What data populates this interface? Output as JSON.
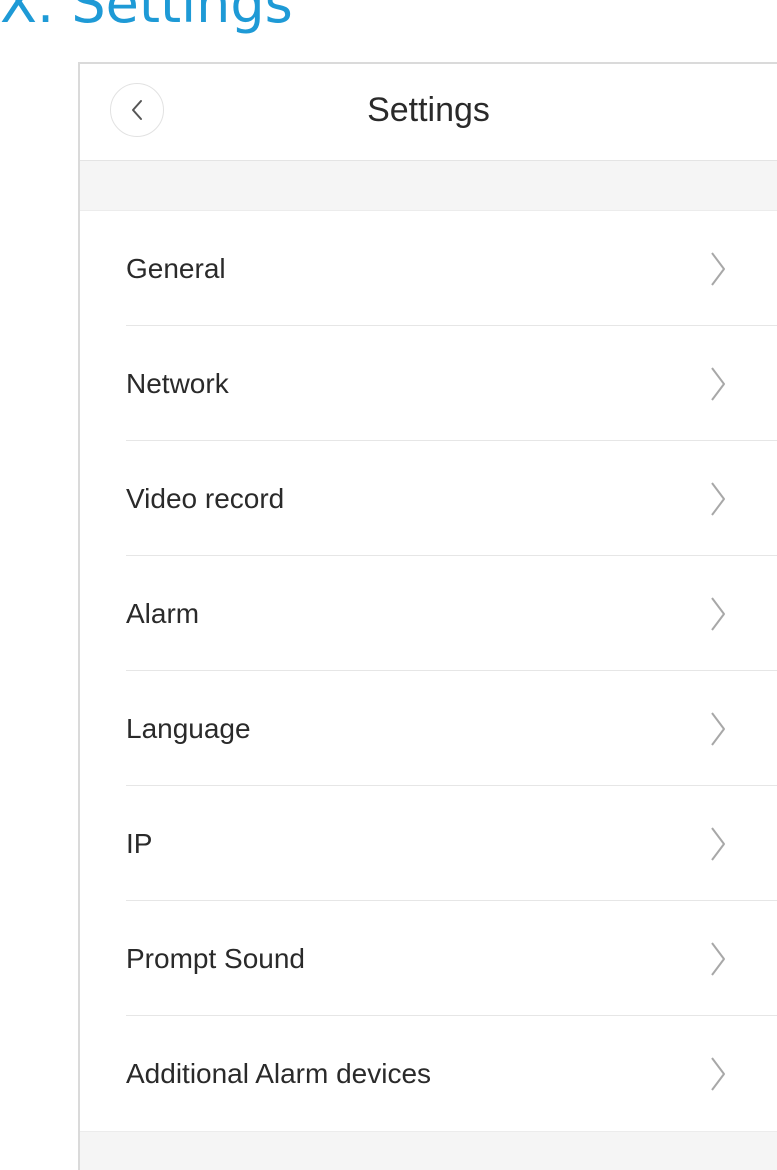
{
  "doc_heading": "X. Settings",
  "nav": {
    "title": "Settings",
    "back_icon": "chevron-left-icon"
  },
  "menu": {
    "items": [
      {
        "label": "General",
        "icon": "chevron-right-icon"
      },
      {
        "label": "Network",
        "icon": "chevron-right-icon"
      },
      {
        "label": "Video record",
        "icon": "chevron-right-icon"
      },
      {
        "label": "Alarm",
        "icon": "chevron-right-icon"
      },
      {
        "label": "Language",
        "icon": "chevron-right-icon"
      },
      {
        "label": "IP",
        "icon": "chevron-right-icon"
      },
      {
        "label": "Prompt Sound",
        "icon": "chevron-right-icon"
      },
      {
        "label": "Additional Alarm devices",
        "icon": "chevron-right-icon"
      }
    ]
  },
  "colors": {
    "heading": "#1e9ad6",
    "text": "#2a2a2a",
    "chevron": "#a8a8a8",
    "divider": "#e6e6e6",
    "section_bg": "#f5f5f5"
  }
}
